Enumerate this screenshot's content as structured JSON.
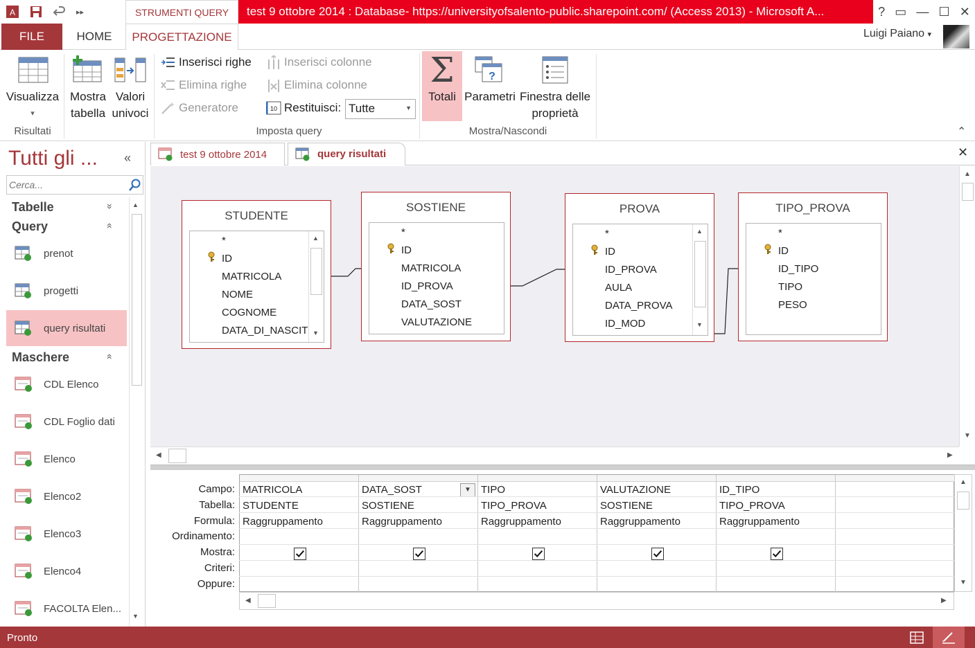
{
  "title_bar": {
    "context_tab": "STRUMENTI QUERY",
    "title": "test 9 ottobre 2014 : Database- https://universityofsalento-public.sharepoint.com/ (Access 2013) -  Microsoft A...",
    "help": "?",
    "minimize": "—",
    "restore": "☐",
    "close": "✕"
  },
  "ribbon_tabs": {
    "file": "FILE",
    "home": "HOME",
    "design": "PROGETTAZIONE"
  },
  "user": {
    "name": "Luigi Paiano",
    "chevron": "▾"
  },
  "ribbon": {
    "visualizza_label": "Visualizza",
    "visualizza_arrow": "▾",
    "risultati_group": "Risultati",
    "mostra_tabella_line1": "Mostra",
    "mostra_tabella_line2": "tabella",
    "valori_univoci_line1": "Valori",
    "valori_univoci_line2": "univoci",
    "inserisci_righe": "Inserisci righe",
    "elimina_righe": "Elimina righe",
    "generatore": "Generatore",
    "inserisci_colonne": "Inserisci colonne",
    "elimina_colonne": "Elimina colonne",
    "restituisci_label": "Restituisci:",
    "restituisci_value": "Tutte",
    "imposta_query_group": "Imposta query",
    "totali": "Totali",
    "parametri": "Parametri",
    "finestra_line1": "Finestra delle",
    "finestra_line2": "proprietà",
    "mostra_nascondi_group": "Mostra/Nascondi",
    "collapse": "⌃"
  },
  "nav": {
    "title": "Tutti gli ...",
    "collapse": "«",
    "search_placeholder": "Cerca...",
    "tabelle": "Tabelle",
    "query": "Query",
    "maschere": "Maschere",
    "chev_down": "»",
    "chev_up": "«",
    "query_items": [
      "prenot",
      "progetti",
      "query risultati"
    ],
    "form_items": [
      "CDL Elenco",
      "CDL Foglio dati",
      "Elenco",
      "Elenco2",
      "Elenco3",
      "Elenco4",
      "FACOLTA Elen..."
    ]
  },
  "doc_tabs": {
    "tab1": "test 9 ottobre 2014",
    "tab2": "query risultati",
    "close": "✕"
  },
  "tables": {
    "studente": {
      "title": "STUDENTE",
      "fields": [
        "*",
        "ID",
        "MATRICOLA",
        "NOME",
        "COGNOME",
        "DATA_DI_NASCIT"
      ]
    },
    "sostiene": {
      "title": "SOSTIENE",
      "fields": [
        "*",
        "ID",
        "MATRICOLA",
        "ID_PROVA",
        "DATA_SOST",
        "VALUTAZIONE"
      ]
    },
    "prova": {
      "title": "PROVA",
      "fields": [
        "*",
        "ID",
        "ID_PROVA",
        "AULA",
        "DATA_PROVA",
        "ID_MOD"
      ]
    },
    "tipo_prova": {
      "title": "TIPO_PROVA",
      "fields": [
        "*",
        "ID",
        "ID_TIPO",
        "TIPO",
        "PESO"
      ]
    }
  },
  "grid": {
    "row_labels": [
      "Campo:",
      "Tabella:",
      "Formula:",
      "Ordinamento:",
      "Mostra:",
      "Criteri:",
      "Oppure:"
    ],
    "columns": [
      {
        "campo": "MATRICOLA",
        "tabella": "STUDENTE",
        "formula": "Raggruppamento",
        "mostra": true
      },
      {
        "campo": "DATA_SOST",
        "tabella": "SOSTIENE",
        "formula": "Raggruppamento",
        "mostra": true
      },
      {
        "campo": "TIPO",
        "tabella": "TIPO_PROVA",
        "formula": "Raggruppamento",
        "mostra": true
      },
      {
        "campo": "VALUTAZIONE",
        "tabella": "SOSTIENE",
        "formula": "Raggruppamento",
        "mostra": true
      },
      {
        "campo": "ID_TIPO",
        "tabella": "TIPO_PROVA",
        "formula": "Raggruppamento",
        "mostra": true
      }
    ]
  },
  "status": {
    "text": "Pronto"
  },
  "colors": {
    "accent": "#a4373a",
    "title_red": "#e8001c",
    "selection": "#f7c2c4",
    "design_bg": "#efeff3"
  }
}
